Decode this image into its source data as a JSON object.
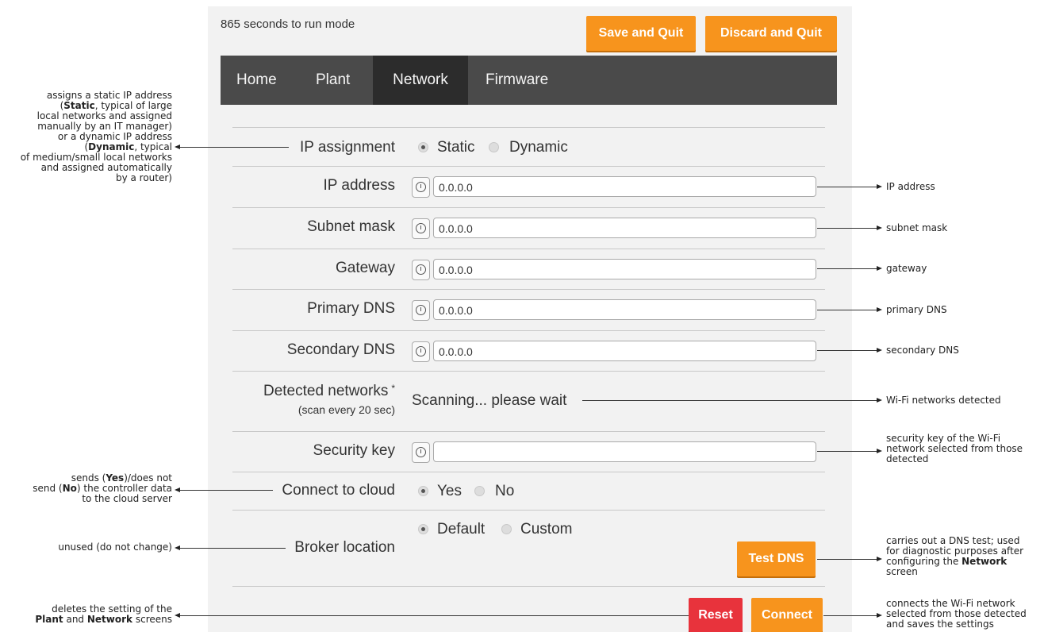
{
  "header": {
    "countdown": "865 seconds to run mode",
    "save_label": "Save and Quit",
    "discard_label": "Discard and Quit"
  },
  "nav": {
    "tabs": [
      {
        "label": "Home"
      },
      {
        "label": "Plant"
      },
      {
        "label": "Network",
        "active": true
      },
      {
        "label": "Firmware"
      }
    ]
  },
  "form": {
    "ip_assignment": {
      "label": "IP assignment",
      "options": [
        "Static",
        "Dynamic"
      ],
      "selected": "Static"
    },
    "ip_address": {
      "label": "IP address",
      "value": "0.0.0.0"
    },
    "subnet_mask": {
      "label": "Subnet mask",
      "value": "0.0.0.0"
    },
    "gateway": {
      "label": "Gateway",
      "value": "0.0.0.0"
    },
    "primary_dns": {
      "label": "Primary DNS",
      "value": "0.0.0.0"
    },
    "secondary_dns": {
      "label": "Secondary DNS",
      "value": "0.0.0.0"
    },
    "detected_networks": {
      "label": "Detected networks",
      "asterisk": "*",
      "sublabel": "(scan every 20 sec)",
      "status": "Scanning... please wait"
    },
    "security_key": {
      "label": "Security key",
      "value": ""
    },
    "connect_to_cloud": {
      "label": "Connect to cloud",
      "options": [
        "Yes",
        "No"
      ],
      "selected": "Yes"
    },
    "broker_location": {
      "label": "Broker location",
      "options": [
        "Default",
        "Custom"
      ],
      "selected": "Default"
    },
    "test_dns_label": "Test DNS",
    "reset_label": "Reset",
    "connect_label": "Connect"
  },
  "annotations": {
    "ip_assignment_1": "assigns a static IP address",
    "ip_assignment_2a": "(",
    "ip_assignment_2b": "Static",
    "ip_assignment_2c": ", typical of large",
    "ip_assignment_3": "local networks and assigned",
    "ip_assignment_4": "manually by an IT manager)",
    "ip_assignment_5": "or a dynamic IP address",
    "ip_assignment_6a": "(",
    "ip_assignment_6b": "Dynamic",
    "ip_assignment_6c": ", typical",
    "ip_assignment_7": "of medium/small local networks",
    "ip_assignment_8": "and assigned automatically",
    "ip_assignment_9": "by a router)",
    "cloud_1a": "sends (",
    "cloud_1b": "Yes",
    "cloud_1c": ")/does not",
    "cloud_2a": "send (",
    "cloud_2b": "No",
    "cloud_2c": ") the controller data",
    "cloud_3": "to the cloud server",
    "broker": "unused (do not change)",
    "reset_1": "deletes the setting of the",
    "reset_2a": "Plant",
    "reset_2b": " and ",
    "reset_2c": "Network",
    "reset_2d": " screens",
    "ip_address": "IP address",
    "subnet_mask": "subnet mask",
    "gateway": "gateway",
    "primary_dns": "primary DNS",
    "secondary_dns": "secondary DNS",
    "wifi": "Wi-Fi networks detected",
    "security_1": "security key of the Wi-Fi",
    "security_2": "network selected from those",
    "security_3": "detected",
    "testdns_1": "carries out a DNS test; used",
    "testdns_2": "for diagnostic purposes after",
    "testdns_3a": "configuring the ",
    "testdns_3b": "Network",
    "testdns_4": "screen",
    "connect_1": "connects the Wi-Fi network",
    "connect_2": "selected from those detected",
    "connect_3": "and saves the settings"
  },
  "colors": {
    "accent": "#f7941d",
    "danger": "#e8333c",
    "nav_bg": "#4a4a4a",
    "nav_active": "#2c2c2c"
  }
}
